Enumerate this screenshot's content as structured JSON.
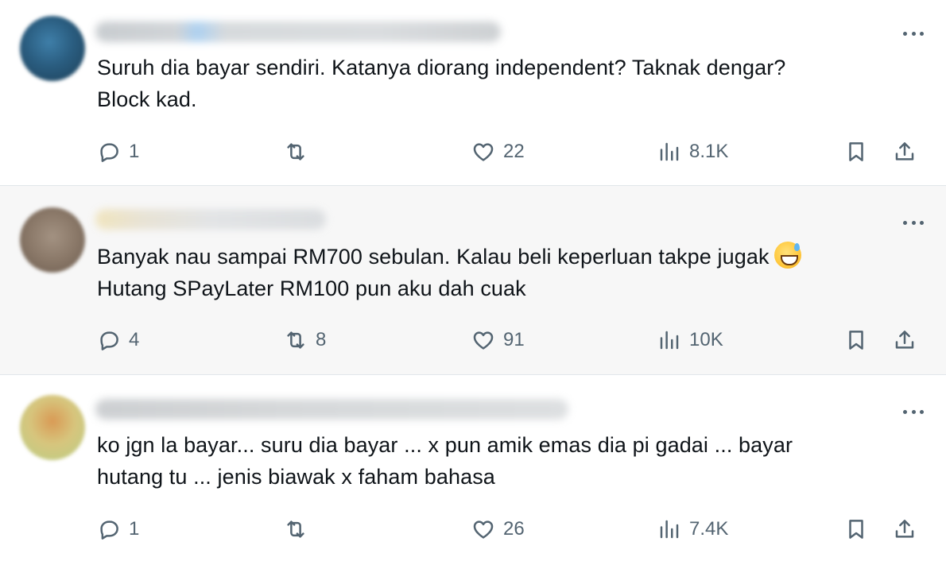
{
  "tweets": [
    {
      "text_lines": [
        "Suruh dia bayar sendiri. Katanya diorang independent? Taknak dengar?",
        "Block kad."
      ],
      "replies": "1",
      "retweets": "",
      "likes": "22",
      "views": "8.1K",
      "highlighted": false
    },
    {
      "text_lines": [
        "Banyak nau sampai RM700 sebulan. Kalau beli keperluan takpe jugak",
        "Hutang SPayLater RM100 pun aku dah cuak"
      ],
      "emoji": "grinning-face-with-sweat",
      "replies": "4",
      "retweets": "8",
      "likes": "91",
      "views": "10K",
      "highlighted": true
    },
    {
      "text_lines": [
        "ko jgn la bayar... suru dia bayar ... x pun amik emas dia pi gadai ... bayar",
        "hutang tu ... jenis biawak x faham bahasa"
      ],
      "replies": "1",
      "retweets": "",
      "likes": "26",
      "views": "7.4K",
      "highlighted": false
    }
  ],
  "icons": {
    "reply": "reply-icon",
    "retweet": "retweet-icon",
    "like": "heart-icon",
    "views": "views-icon",
    "bookmark": "bookmark-icon",
    "share": "share-icon",
    "more": "more-icon"
  },
  "colors": {
    "text": "#0f1419",
    "muted": "#536471",
    "highlight_bg": "#f7f7f7",
    "divider": "#e1e6ea"
  }
}
